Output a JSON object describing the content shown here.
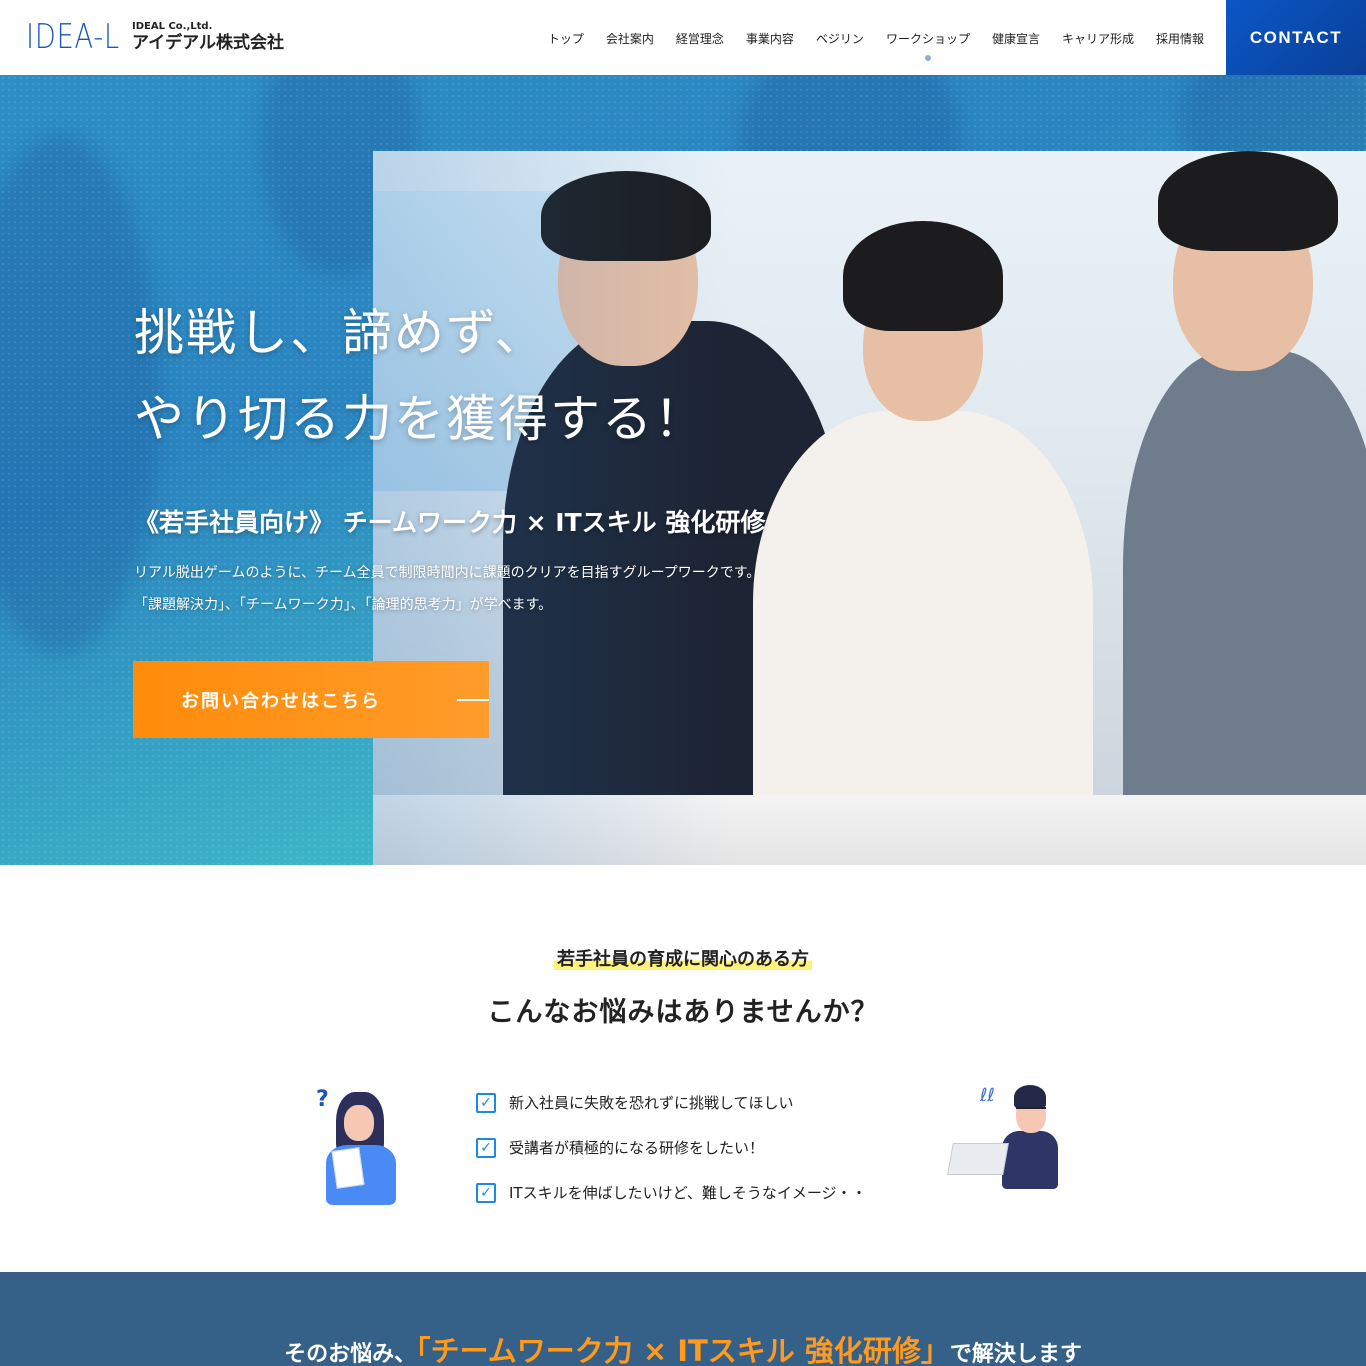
{
  "header": {
    "logo_mark": "IDEA-L",
    "company_en": "IDEAL Co.,Ltd.",
    "company_jp": "アイデアル株式会社",
    "nav": [
      {
        "label": "トップ",
        "active": false
      },
      {
        "label": "会社案内",
        "active": false
      },
      {
        "label": "経営理念",
        "active": false
      },
      {
        "label": "事業内容",
        "active": false
      },
      {
        "label": "ベジリン",
        "active": false
      },
      {
        "label": "ワークショップ",
        "active": true
      },
      {
        "label": "健康宣言",
        "active": false
      },
      {
        "label": "キャリア形成",
        "active": false
      },
      {
        "label": "採用情報",
        "active": false
      }
    ],
    "contact_label": "CONTACT"
  },
  "hero": {
    "title_line1": "挑戦し、諦めず、",
    "title_line2": "やり切る力を獲得する！",
    "subtitle": "《若手社員向け》 チームワーク力 × ITスキル 強化研修",
    "desc_line1": "リアル脱出ゲームのように、チーム全員で制限時間内に課題のクリアを目指すグループワークです。",
    "desc_line2": "「課題解決力」、「チームワーク力」、「論理的思考力」が学べます。",
    "cta_label": "お問い合わせはこちら"
  },
  "concerns": {
    "tagline": "若手社員の育成に関心のある方",
    "title": "こんなお悩みはありませんか？",
    "items": [
      "新入社員に失敗を恐れずに挑戦してほしい",
      "受講者が積極的になる研修をしたい！",
      "ITスキルを伸ばしたいけど、難しそうなイメージ・・"
    ],
    "check_icon": "✓",
    "question_icon": "?",
    "swirl_icon": "ℓℓ"
  },
  "solution": {
    "prefix": "そのお悩み、",
    "highlight": "「チームワーク力 × ITスキル 強化研修」",
    "suffix": "で解決します"
  },
  "colors": {
    "brand_blue": "#1a56b8",
    "contact_bg": "#0b57c6",
    "cta_orange": "#ff8c0a",
    "check_blue": "#1a8ae6",
    "marker_yellow": "#fff27a",
    "solution_bg": "#356087",
    "solution_highlight": "#ff9a1f"
  }
}
